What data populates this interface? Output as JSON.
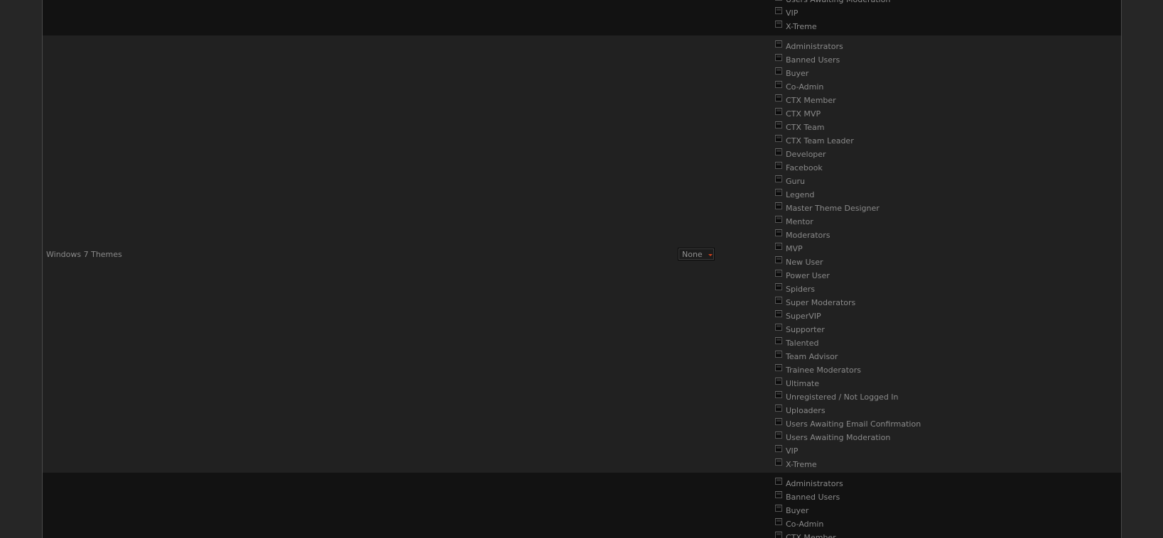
{
  "rows": [
    {
      "label": "",
      "groups": [
        "Users Awaiting Moderation",
        "VIP",
        "X-Treme"
      ]
    },
    {
      "label": "Windows 7 Themes",
      "select_value": "None",
      "groups": [
        "Administrators",
        "Banned Users",
        "Buyer",
        "Co-Admin",
        "CTX Member",
        "CTX MVP",
        "CTX Team",
        "CTX Team Leader",
        "Developer",
        "Facebook",
        "Guru",
        "Legend",
        "Master Theme Designer",
        "Mentor",
        "Moderators",
        "MVP",
        "New User",
        "Power User",
        "Spiders",
        "Super Moderators",
        "SuperVIP",
        "Supporter",
        "Talented",
        "Team Advisor",
        "Trainee Moderators",
        "Ultimate",
        "Unregistered / Not Logged In",
        "Uploaders",
        "Users Awaiting Email Confirmation",
        "Users Awaiting Moderation",
        "VIP",
        "X-Treme"
      ]
    },
    {
      "label": "",
      "groups": [
        "Administrators",
        "Banned Users",
        "Buyer",
        "Co-Admin",
        "CTX Member"
      ]
    }
  ],
  "colors": {
    "page_background": "#262626",
    "row_dark": "#121212",
    "row_light": "#212121",
    "text": "#8a8a8a",
    "select_arrow": "#d0401a"
  },
  "icons": {
    "select_arrow": "chevron-down-icon",
    "checkbox": "checkbox-icon"
  }
}
